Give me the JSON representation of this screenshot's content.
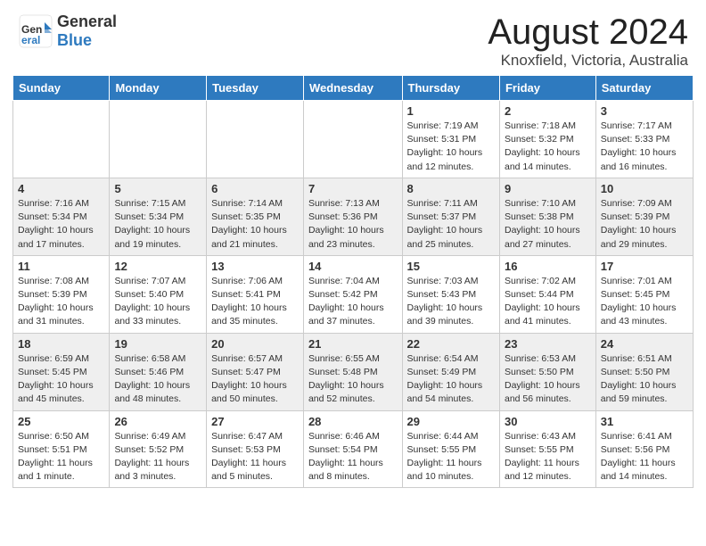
{
  "header": {
    "logo_line1": "General",
    "logo_line2": "Blue",
    "title": "August 2024",
    "subtitle": "Knoxfield, Victoria, Australia"
  },
  "days_of_week": [
    "Sunday",
    "Monday",
    "Tuesday",
    "Wednesday",
    "Thursday",
    "Friday",
    "Saturday"
  ],
  "weeks": [
    [
      {
        "day": "",
        "info": ""
      },
      {
        "day": "",
        "info": ""
      },
      {
        "day": "",
        "info": ""
      },
      {
        "day": "",
        "info": ""
      },
      {
        "day": "1",
        "info": "Sunrise: 7:19 AM\nSunset: 5:31 PM\nDaylight: 10 hours\nand 12 minutes."
      },
      {
        "day": "2",
        "info": "Sunrise: 7:18 AM\nSunset: 5:32 PM\nDaylight: 10 hours\nand 14 minutes."
      },
      {
        "day": "3",
        "info": "Sunrise: 7:17 AM\nSunset: 5:33 PM\nDaylight: 10 hours\nand 16 minutes."
      }
    ],
    [
      {
        "day": "4",
        "info": "Sunrise: 7:16 AM\nSunset: 5:34 PM\nDaylight: 10 hours\nand 17 minutes."
      },
      {
        "day": "5",
        "info": "Sunrise: 7:15 AM\nSunset: 5:34 PM\nDaylight: 10 hours\nand 19 minutes."
      },
      {
        "day": "6",
        "info": "Sunrise: 7:14 AM\nSunset: 5:35 PM\nDaylight: 10 hours\nand 21 minutes."
      },
      {
        "day": "7",
        "info": "Sunrise: 7:13 AM\nSunset: 5:36 PM\nDaylight: 10 hours\nand 23 minutes."
      },
      {
        "day": "8",
        "info": "Sunrise: 7:11 AM\nSunset: 5:37 PM\nDaylight: 10 hours\nand 25 minutes."
      },
      {
        "day": "9",
        "info": "Sunrise: 7:10 AM\nSunset: 5:38 PM\nDaylight: 10 hours\nand 27 minutes."
      },
      {
        "day": "10",
        "info": "Sunrise: 7:09 AM\nSunset: 5:39 PM\nDaylight: 10 hours\nand 29 minutes."
      }
    ],
    [
      {
        "day": "11",
        "info": "Sunrise: 7:08 AM\nSunset: 5:39 PM\nDaylight: 10 hours\nand 31 minutes."
      },
      {
        "day": "12",
        "info": "Sunrise: 7:07 AM\nSunset: 5:40 PM\nDaylight: 10 hours\nand 33 minutes."
      },
      {
        "day": "13",
        "info": "Sunrise: 7:06 AM\nSunset: 5:41 PM\nDaylight: 10 hours\nand 35 minutes."
      },
      {
        "day": "14",
        "info": "Sunrise: 7:04 AM\nSunset: 5:42 PM\nDaylight: 10 hours\nand 37 minutes."
      },
      {
        "day": "15",
        "info": "Sunrise: 7:03 AM\nSunset: 5:43 PM\nDaylight: 10 hours\nand 39 minutes."
      },
      {
        "day": "16",
        "info": "Sunrise: 7:02 AM\nSunset: 5:44 PM\nDaylight: 10 hours\nand 41 minutes."
      },
      {
        "day": "17",
        "info": "Sunrise: 7:01 AM\nSunset: 5:45 PM\nDaylight: 10 hours\nand 43 minutes."
      }
    ],
    [
      {
        "day": "18",
        "info": "Sunrise: 6:59 AM\nSunset: 5:45 PM\nDaylight: 10 hours\nand 45 minutes."
      },
      {
        "day": "19",
        "info": "Sunrise: 6:58 AM\nSunset: 5:46 PM\nDaylight: 10 hours\nand 48 minutes."
      },
      {
        "day": "20",
        "info": "Sunrise: 6:57 AM\nSunset: 5:47 PM\nDaylight: 10 hours\nand 50 minutes."
      },
      {
        "day": "21",
        "info": "Sunrise: 6:55 AM\nSunset: 5:48 PM\nDaylight: 10 hours\nand 52 minutes."
      },
      {
        "day": "22",
        "info": "Sunrise: 6:54 AM\nSunset: 5:49 PM\nDaylight: 10 hours\nand 54 minutes."
      },
      {
        "day": "23",
        "info": "Sunrise: 6:53 AM\nSunset: 5:50 PM\nDaylight: 10 hours\nand 56 minutes."
      },
      {
        "day": "24",
        "info": "Sunrise: 6:51 AM\nSunset: 5:50 PM\nDaylight: 10 hours\nand 59 minutes."
      }
    ],
    [
      {
        "day": "25",
        "info": "Sunrise: 6:50 AM\nSunset: 5:51 PM\nDaylight: 11 hours\nand 1 minute."
      },
      {
        "day": "26",
        "info": "Sunrise: 6:49 AM\nSunset: 5:52 PM\nDaylight: 11 hours\nand 3 minutes."
      },
      {
        "day": "27",
        "info": "Sunrise: 6:47 AM\nSunset: 5:53 PM\nDaylight: 11 hours\nand 5 minutes."
      },
      {
        "day": "28",
        "info": "Sunrise: 6:46 AM\nSunset: 5:54 PM\nDaylight: 11 hours\nand 8 minutes."
      },
      {
        "day": "29",
        "info": "Sunrise: 6:44 AM\nSunset: 5:55 PM\nDaylight: 11 hours\nand 10 minutes."
      },
      {
        "day": "30",
        "info": "Sunrise: 6:43 AM\nSunset: 5:55 PM\nDaylight: 11 hours\nand 12 minutes."
      },
      {
        "day": "31",
        "info": "Sunrise: 6:41 AM\nSunset: 5:56 PM\nDaylight: 11 hours\nand 14 minutes."
      }
    ]
  ]
}
